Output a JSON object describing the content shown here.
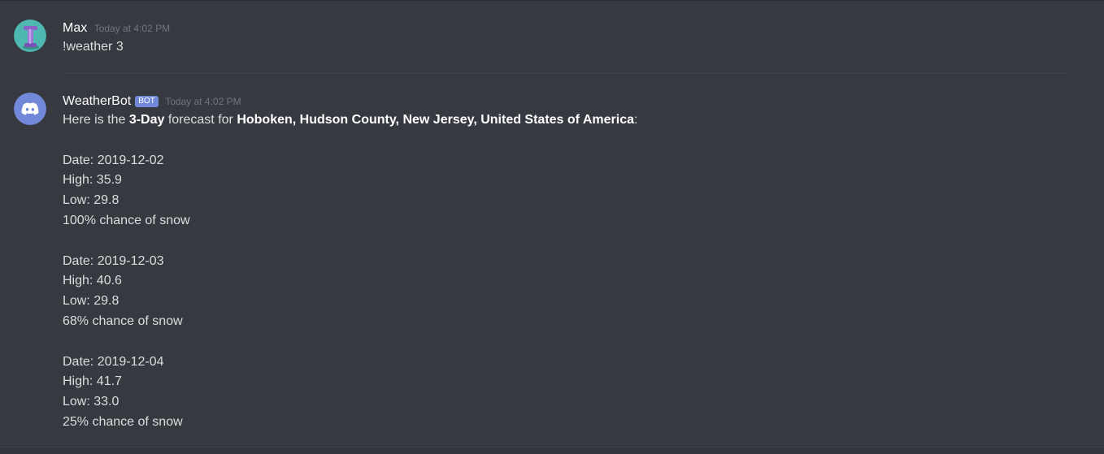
{
  "messages": [
    {
      "username": "Max",
      "timestamp": "Today at 4:02 PM",
      "text": "!weather 3"
    },
    {
      "username": "WeatherBot",
      "bot_tag": "BOT",
      "timestamp": "Today at 4:02 PM",
      "intro": {
        "prefix": "Here is the ",
        "bold_days": "3-Day",
        "middle": " forecast for ",
        "bold_location": "Hoboken, Hudson County, New Jersey, United States of America",
        "suffix": ":"
      },
      "forecasts": [
        {
          "date": "Date: 2019-12-02",
          "high": "High:  35.9",
          "low": "Low:  29.8",
          "snow": "100% chance of snow"
        },
        {
          "date": "Date: 2019-12-03",
          "high": "High:  40.6",
          "low": "Low:  29.8",
          "snow": "68% chance of snow"
        },
        {
          "date": "Date: 2019-12-04",
          "high": "High:  41.7",
          "low": "Low:  33.0",
          "snow": "25% chance of snow"
        }
      ]
    }
  ],
  "colors": {
    "background": "#36393f",
    "bot_tag": "#7289da",
    "discord_avatar": "#7289da",
    "max_avatar_bg": "#4fb8b0"
  },
  "icons": {
    "max_avatar": "purple-pillar-avatar",
    "bot_avatar": "discord-logo-icon"
  }
}
